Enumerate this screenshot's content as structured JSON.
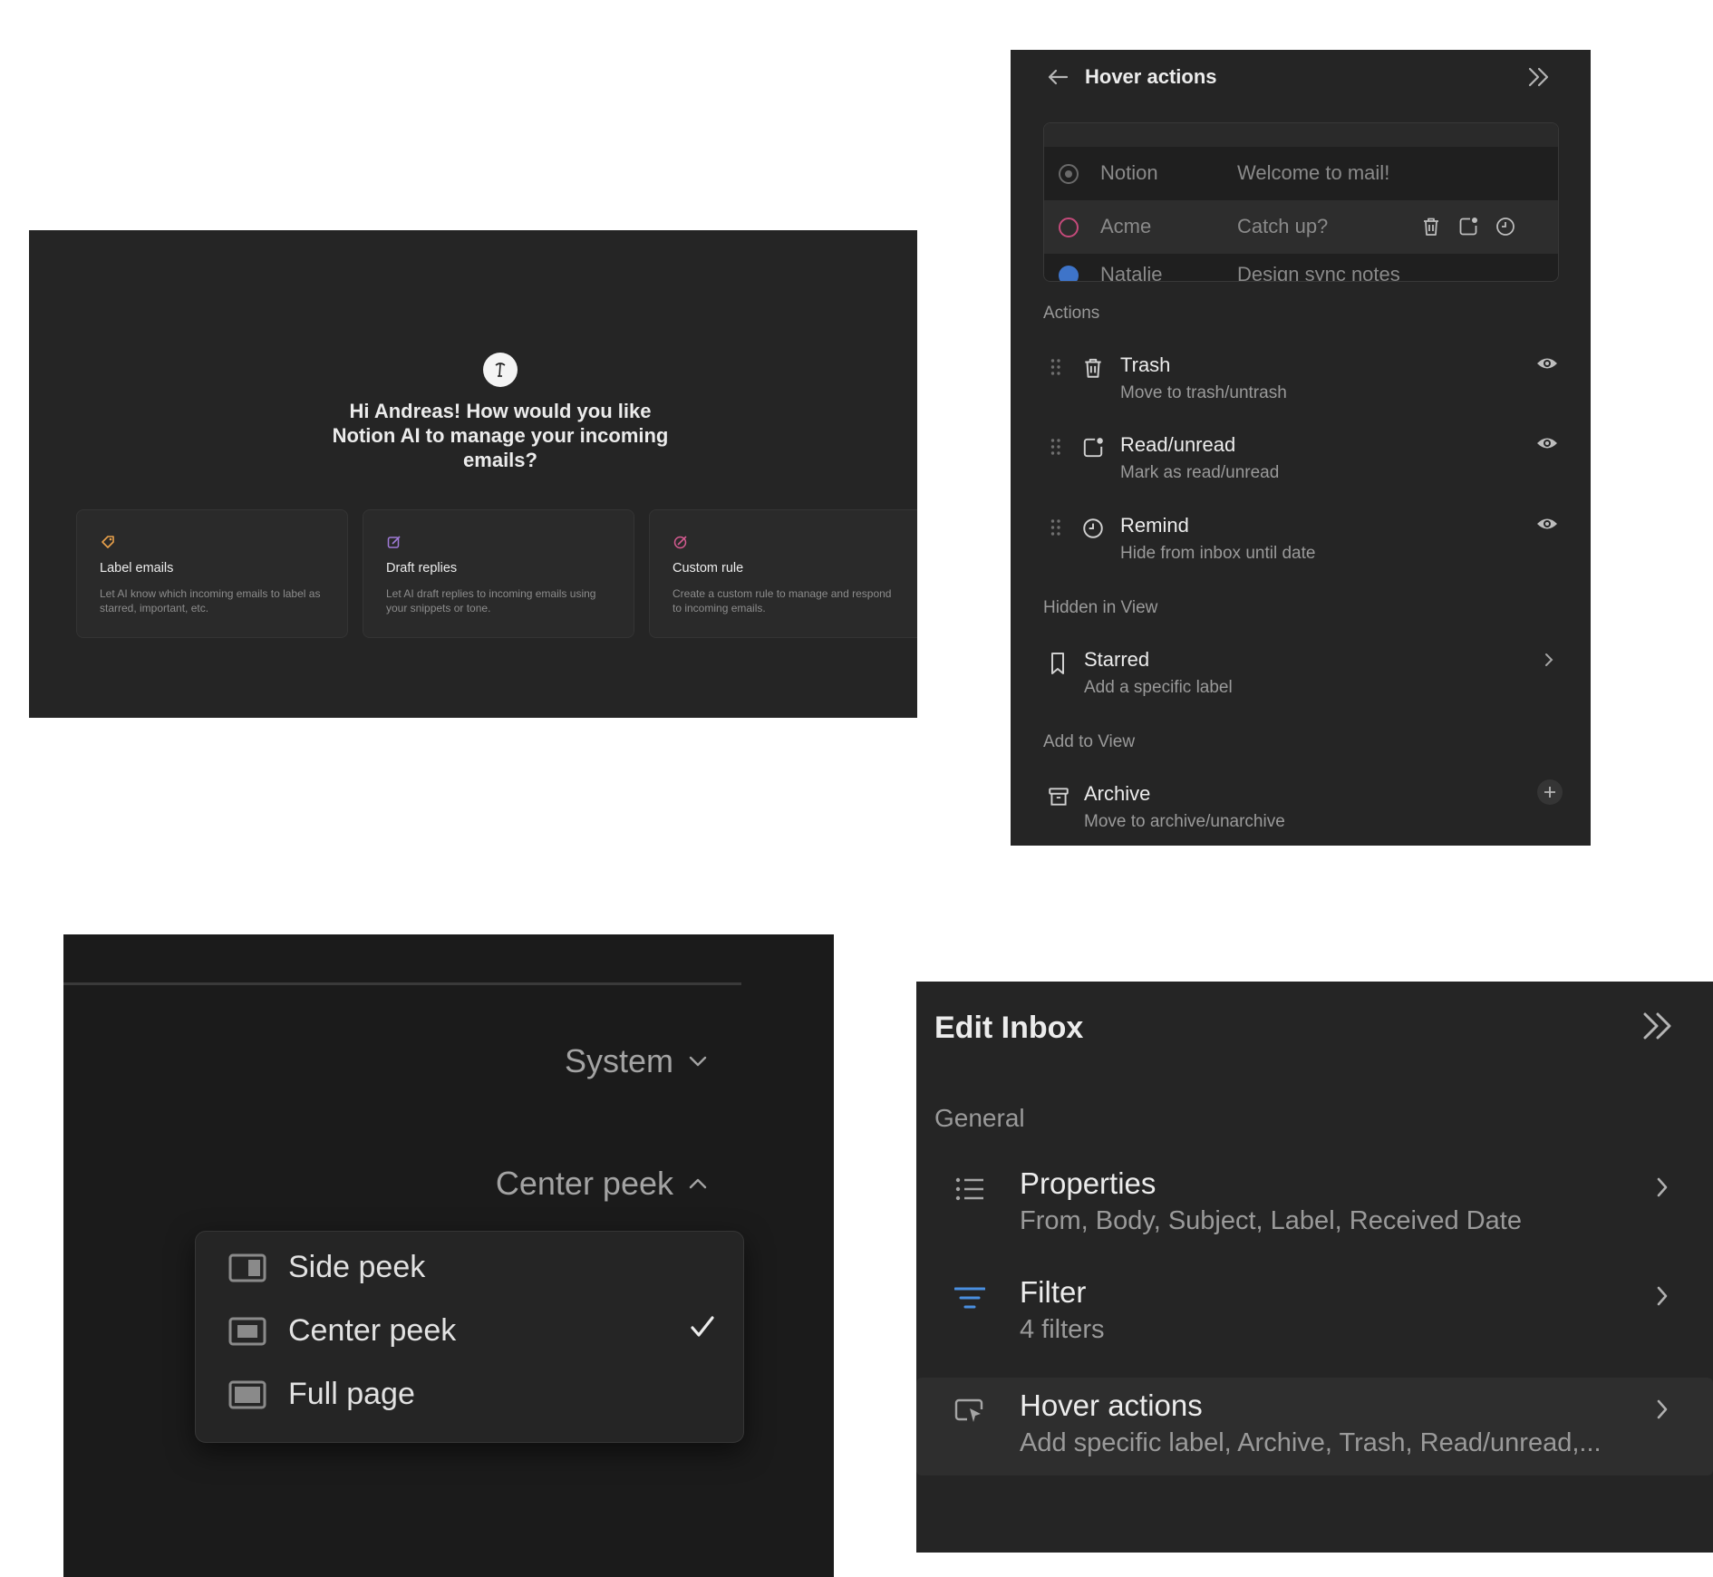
{
  "ai_onboarding": {
    "greeting": "Hi Andreas! How would you like Notion AI to manage your incoming emails?",
    "cards": [
      {
        "title": "Label emails",
        "desc": "Let AI know which incoming emails to label as starred, important, etc.",
        "icon": "tag-icon",
        "color": "#e8a04a"
      },
      {
        "title": "Draft replies",
        "desc": "Let AI draft replies to incoming emails using your snippets or tone.",
        "icon": "edit-icon",
        "color": "#a07ad8"
      },
      {
        "title": "Custom rule",
        "desc": "Create a custom rule to manage and respond to incoming emails.",
        "icon": "custom-rule-icon",
        "color": "#d35a8f"
      }
    ]
  },
  "hover_actions": {
    "title": "Hover actions",
    "preview_rows": [
      {
        "from": "Notion",
        "subject": "Welcome to mail!"
      },
      {
        "from": "Acme",
        "subject": "Catch up?"
      },
      {
        "from": "Natalie",
        "subject": "Design sync notes"
      }
    ],
    "sections": {
      "actions": "Actions",
      "hidden": "Hidden in View",
      "add": "Add to View"
    },
    "actions": [
      {
        "title": "Trash",
        "desc": "Move to trash/untrash",
        "icon": "trash-icon"
      },
      {
        "title": "Read/unread",
        "desc": "Mark as read/unread",
        "icon": "read-unread-icon"
      },
      {
        "title": "Remind",
        "desc": "Hide from inbox until date",
        "icon": "clock-icon"
      }
    ],
    "hidden": [
      {
        "title": "Starred",
        "desc": "Add a specific label",
        "icon": "bookmark-icon"
      }
    ],
    "add": [
      {
        "title": "Archive",
        "desc": "Move to archive/unarchive",
        "icon": "archive-icon"
      }
    ]
  },
  "peek_menu": {
    "theme_value": "System",
    "open_value": "Center peek",
    "options": [
      "Side peek",
      "Center peek",
      "Full page"
    ],
    "selected_index": 1
  },
  "edit_inbox": {
    "title": "Edit Inbox",
    "section": "General",
    "rows": [
      {
        "title": "Properties",
        "desc": "From, Body, Subject, Label, Received Date",
        "icon": "list-icon"
      },
      {
        "title": "Filter",
        "desc": "4 filters",
        "icon": "filter-icon",
        "accent": "#4a8fe0"
      },
      {
        "title": "Hover actions",
        "desc": "Add specific label, Archive, Trash, Read/unread,...",
        "icon": "cursor-box-icon"
      }
    ]
  }
}
